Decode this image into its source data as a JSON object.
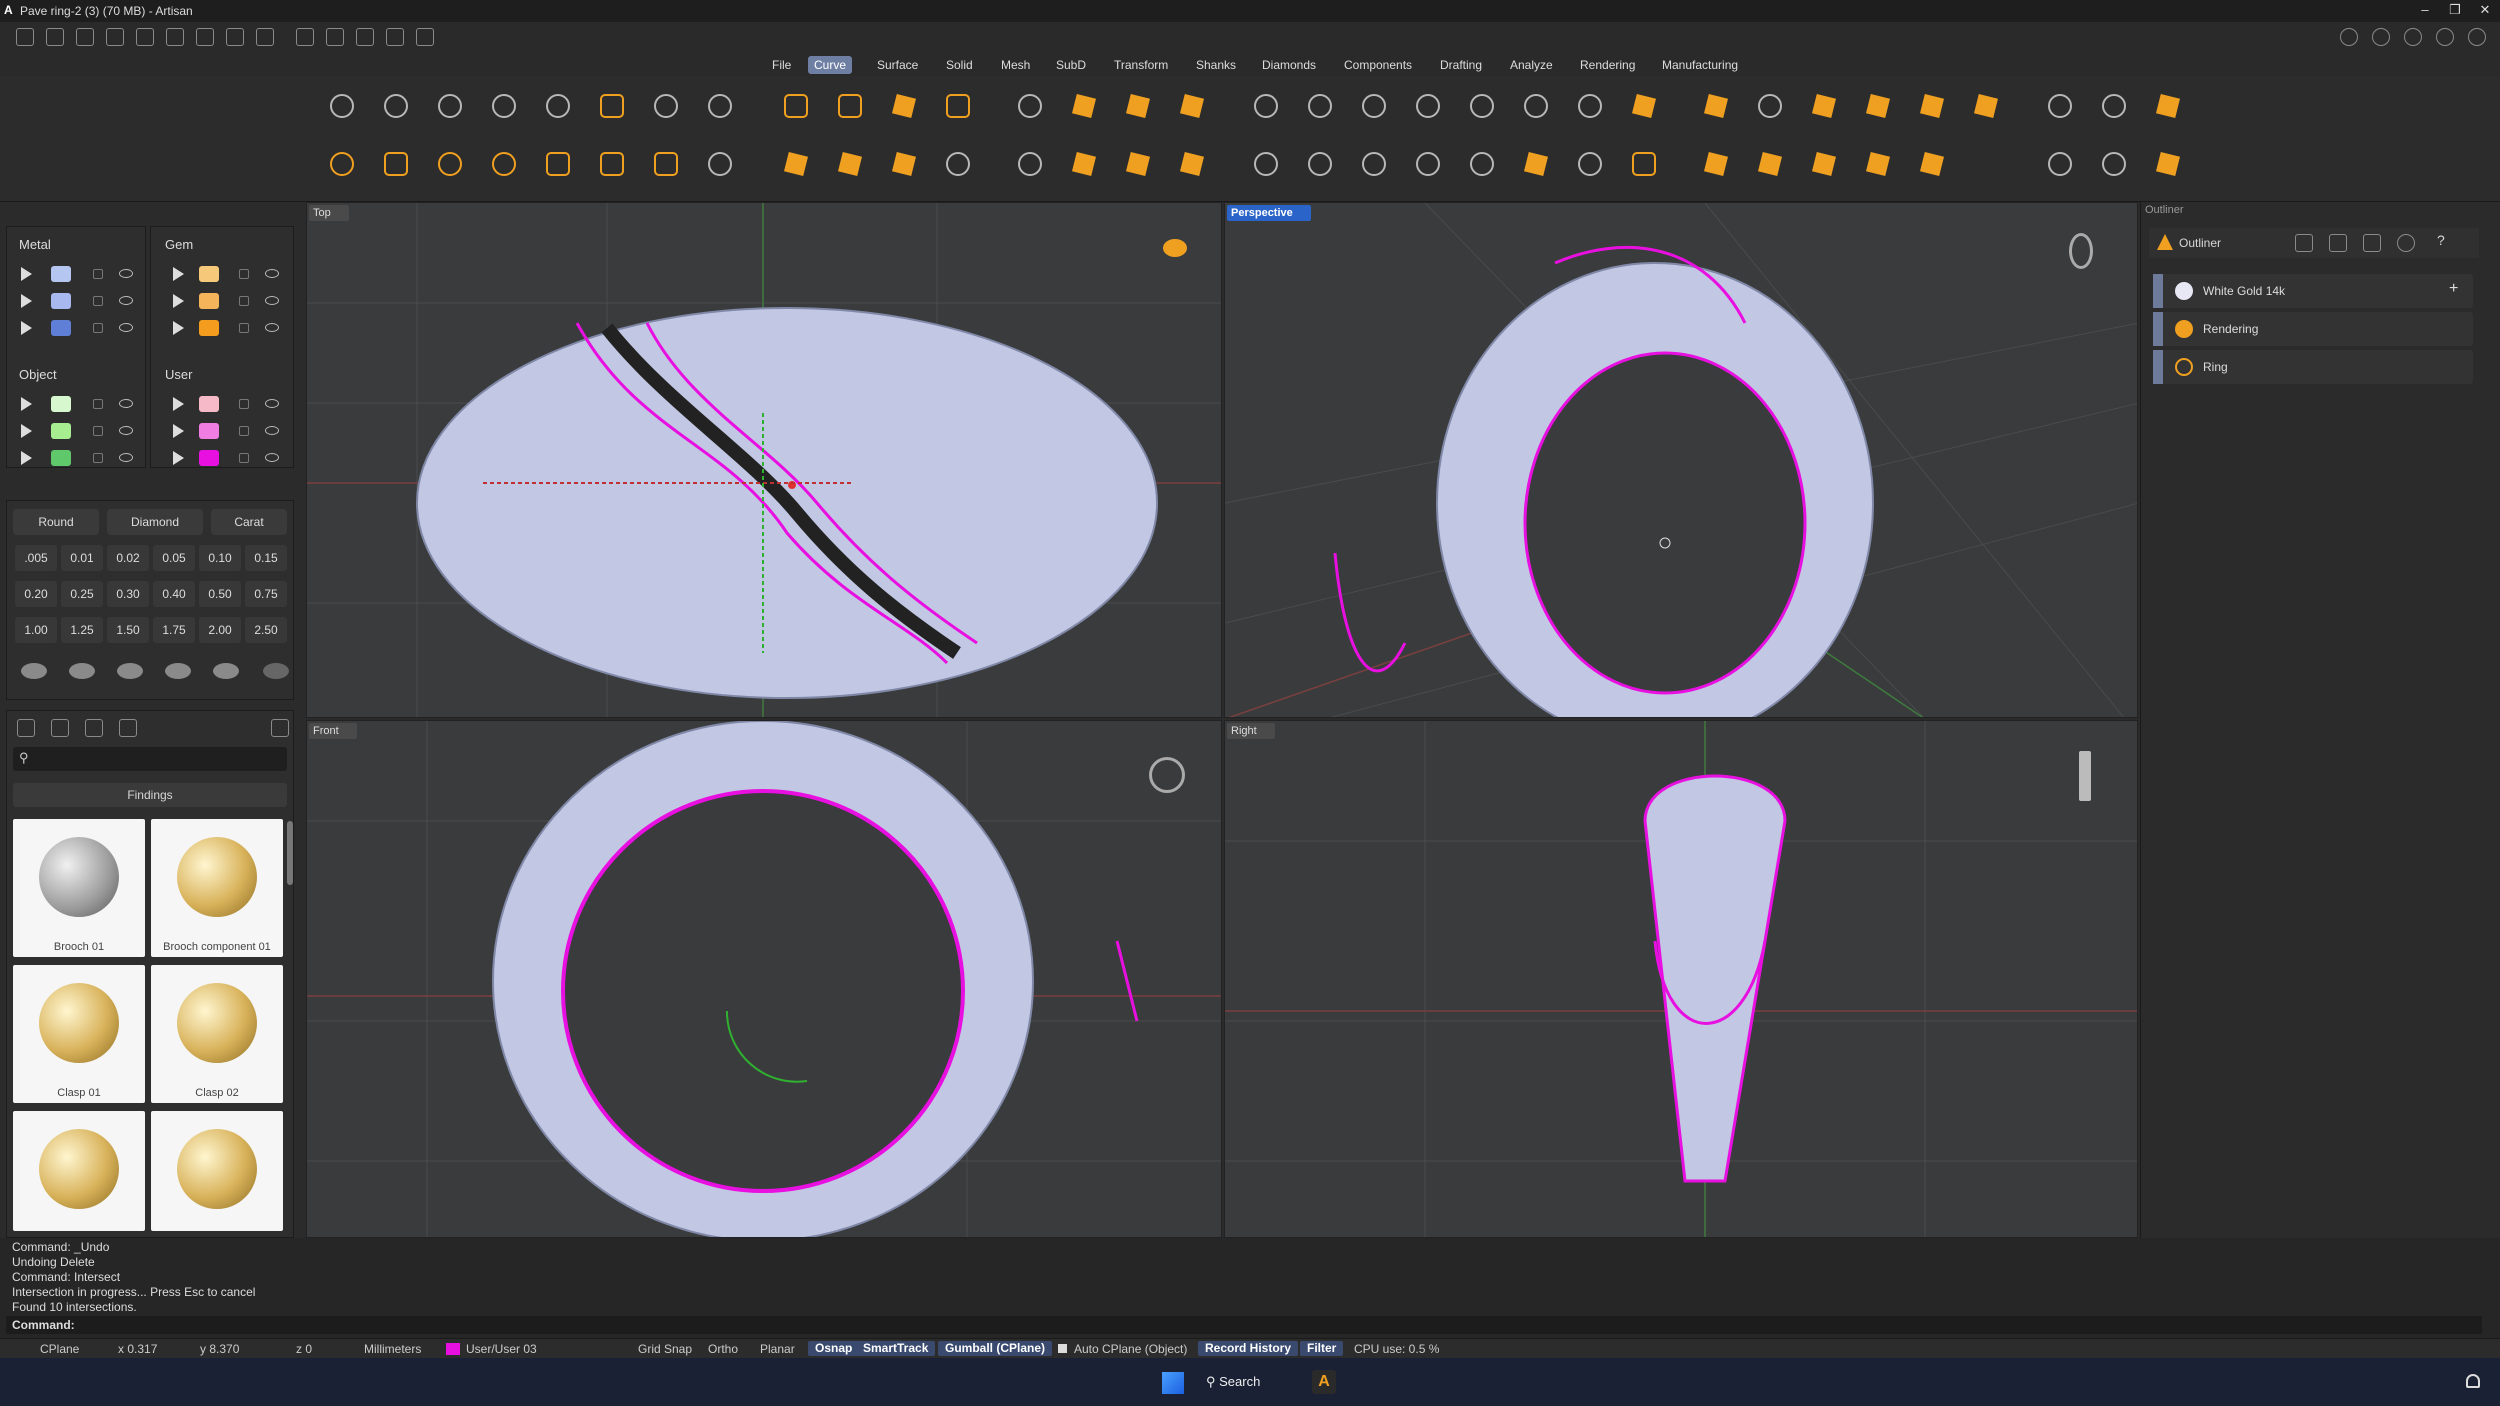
{
  "window": {
    "title": "Pave ring-2 (3) (70 MB) - Artisan",
    "app_logo": "A"
  },
  "menu": [
    "File",
    "Curve",
    "Surface",
    "Solid",
    "Mesh",
    "SubD",
    "Transform",
    "Shanks",
    "Diamonds",
    "Components",
    "Drafting",
    "Analyze",
    "Rendering",
    "Manufacturing"
  ],
  "menu_active": "Curve",
  "layers": {
    "metal": {
      "title": "Metal",
      "swatches": [
        "#b5c7f0",
        "#a7b9ee",
        "#5f7fd6"
      ]
    },
    "gem": {
      "title": "Gem",
      "swatches": [
        "#f6c87a",
        "#f4b55a",
        "#f39c1e"
      ]
    },
    "object": {
      "title": "Object",
      "swatches": [
        "#d7f7cf",
        "#a6ee90",
        "#5fc86a"
      ]
    },
    "user": {
      "title": "User",
      "swatches": [
        "#f6b9c8",
        "#f07de2",
        "#e80fe1"
      ]
    }
  },
  "gem_tools": {
    "round": "Round",
    "diamond": "Diamond",
    "carat": "Carat"
  },
  "gem_sizes": [
    ".005",
    "0.01",
    "0.02",
    "0.05",
    "0.10",
    "0.15",
    "0.20",
    "0.25",
    "0.30",
    "0.40",
    "0.50",
    "0.75",
    "1.00",
    "1.25",
    "1.50",
    "1.75",
    "2.00",
    "2.50"
  ],
  "library": {
    "category": "Findings",
    "items": [
      "Brooch 01",
      "Brooch component 01",
      "Clasp 01",
      "Clasp 02",
      "",
      ""
    ]
  },
  "viewports": {
    "top": "Top",
    "perspective": "Perspective",
    "front": "Front",
    "right": "Right"
  },
  "outliner": {
    "panel_title": "Outliner",
    "header": "Outliner",
    "items": [
      "White Gold 14k",
      "Rendering",
      "Ring"
    ],
    "add_label": "+",
    "help_label": "?"
  },
  "command_history": [
    "Command: _Undo",
    "Undoing Delete",
    "Command: Intersect",
    "Intersection in progress... Press Esc to cancel",
    "Found 10 intersections."
  ],
  "command_prompt": "Command:",
  "status": {
    "cplane": "CPlane",
    "x": "x 0.317",
    "y": "y 8.370",
    "z": "z 0",
    "units": "Millimeters",
    "layer": "User/User 03",
    "layer_color": "#e80fe1",
    "grid_snap": "Grid Snap",
    "ortho": "Ortho",
    "planar": "Planar",
    "osnap": "Osnap",
    "smarttrack": "SmartTrack",
    "gumball": "Gumball (CPlane)",
    "auto_cplane": "Auto CPlane (Object)",
    "record_history": "Record History",
    "filter": "Filter",
    "cpu": "CPU use: 0.5 %"
  },
  "taskbar": {
    "search": "Search"
  },
  "colors": {
    "accent": "#2b64c8",
    "curve": "#e80fe1",
    "ribbon_icon": "#f0a020",
    "ring_surface": "#c6cbea"
  }
}
